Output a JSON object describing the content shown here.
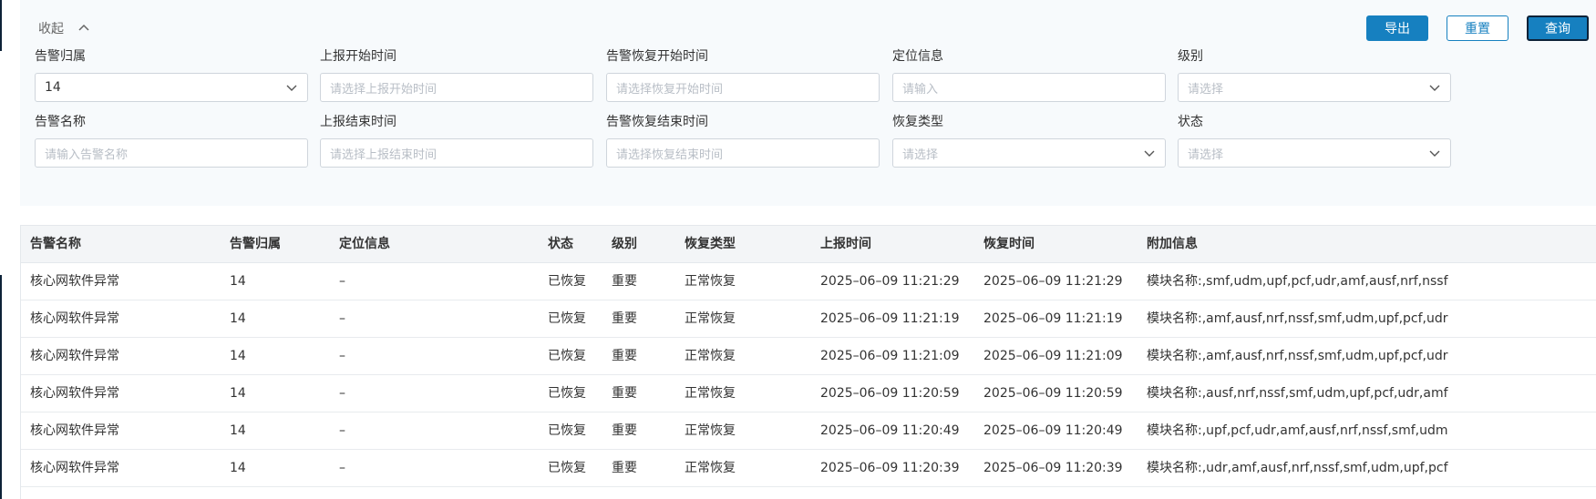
{
  "filters": {
    "collapse_label": "收起",
    "row1": [
      {
        "label": "告警归属",
        "value": "14",
        "placeholder": "",
        "dropdown": true
      },
      {
        "label": "上报开始时间",
        "value": "",
        "placeholder": "请选择上报开始时间",
        "dropdown": false
      },
      {
        "label": "告警恢复开始时间",
        "value": "",
        "placeholder": "请选择恢复开始时间",
        "dropdown": false
      },
      {
        "label": "定位信息",
        "value": "",
        "placeholder": "请输入",
        "dropdown": false
      },
      {
        "label": "级别",
        "value": "",
        "placeholder": "请选择",
        "dropdown": true
      }
    ],
    "row2": [
      {
        "label": "告警名称",
        "value": "",
        "placeholder": "请输入告警名称",
        "dropdown": false
      },
      {
        "label": "上报结束时间",
        "value": "",
        "placeholder": "请选择上报结束时间",
        "dropdown": false
      },
      {
        "label": "告警恢复结束时间",
        "value": "",
        "placeholder": "请选择恢复结束时间",
        "dropdown": false
      },
      {
        "label": "恢复类型",
        "value": "",
        "placeholder": "请选择",
        "dropdown": true
      },
      {
        "label": "状态",
        "value": "",
        "placeholder": "请选择",
        "dropdown": true
      }
    ]
  },
  "actions": {
    "export_label": "导出",
    "reset_label": "重置",
    "query_label": "查询"
  },
  "table": {
    "columns": [
      "告警名称",
      "告警归属",
      "定位信息",
      "状态",
      "级别",
      "恢复类型",
      "上报时间",
      "恢复时间",
      "附加信息"
    ],
    "rows": [
      [
        "核心网软件异常",
        "14",
        "–",
        "已恢复",
        "重要",
        "正常恢复",
        "2025–06–09 11:21:29",
        "2025–06–09 11:21:29",
        "模块名称:,smf,udm,upf,pcf,udr,amf,ausf,nrf,nssf"
      ],
      [
        "核心网软件异常",
        "14",
        "–",
        "已恢复",
        "重要",
        "正常恢复",
        "2025–06–09 11:21:19",
        "2025–06–09 11:21:19",
        "模块名称:,amf,ausf,nrf,nssf,smf,udm,upf,pcf,udr"
      ],
      [
        "核心网软件异常",
        "14",
        "–",
        "已恢复",
        "重要",
        "正常恢复",
        "2025–06–09 11:21:09",
        "2025–06–09 11:21:09",
        "模块名称:,amf,ausf,nrf,nssf,smf,udm,upf,pcf,udr"
      ],
      [
        "核心网软件异常",
        "14",
        "–",
        "已恢复",
        "重要",
        "正常恢复",
        "2025–06–09 11:20:59",
        "2025–06–09 11:20:59",
        "模块名称:,ausf,nrf,nssf,smf,udm,upf,pcf,udr,amf"
      ],
      [
        "核心网软件异常",
        "14",
        "–",
        "已恢复",
        "重要",
        "正常恢复",
        "2025–06–09 11:20:49",
        "2025–06–09 11:20:49",
        "模块名称:,upf,pcf,udr,amf,ausf,nrf,nssf,smf,udm"
      ],
      [
        "核心网软件异常",
        "14",
        "–",
        "已恢复",
        "重要",
        "正常恢复",
        "2025–06–09 11:20:39",
        "2025–06–09 11:20:39",
        "模块名称:,udr,amf,ausf,nrf,nssf,smf,udm,upf,pcf"
      ]
    ]
  },
  "colors": {
    "primary": "#1680c0",
    "panel_bg": "#f7fafc",
    "header_bg": "#f3f5f7"
  }
}
